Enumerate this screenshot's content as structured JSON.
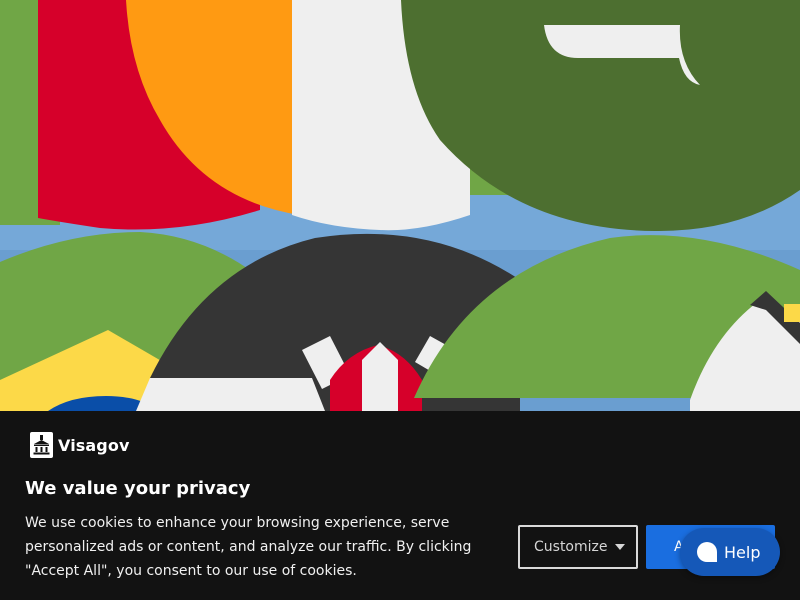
{
  "hero": {
    "illustration_icon": "flags-collage-illustration",
    "colors": {
      "sky": "#6a9ed0",
      "green": "#70a646",
      "dark_green": "#4d6f30",
      "red": "#d6002a",
      "orange": "#ff9a12",
      "white": "#efefef",
      "charcoal": "#353535",
      "yellow": "#fcd948",
      "blue": "#0a4ea8"
    }
  },
  "cookie_banner": {
    "brand": {
      "name": "Visagov",
      "logo_icon": "government-building-icon"
    },
    "title": "We value your privacy",
    "body": "We use cookies to enhance your browsing experience, serve personalized ads or content, and analyze our traffic. By clicking \"Accept All\", you consent to our use of cookies.",
    "buttons": {
      "customize_label": "Customize",
      "customize_icon": "caret-down-icon",
      "accept_label": "Accept All"
    },
    "colors": {
      "background": "#121212",
      "accent": "#1a6ee0"
    }
  },
  "help_widget": {
    "label": "Help",
    "icon": "chat-bubble-icon",
    "color": "#1558b8"
  }
}
